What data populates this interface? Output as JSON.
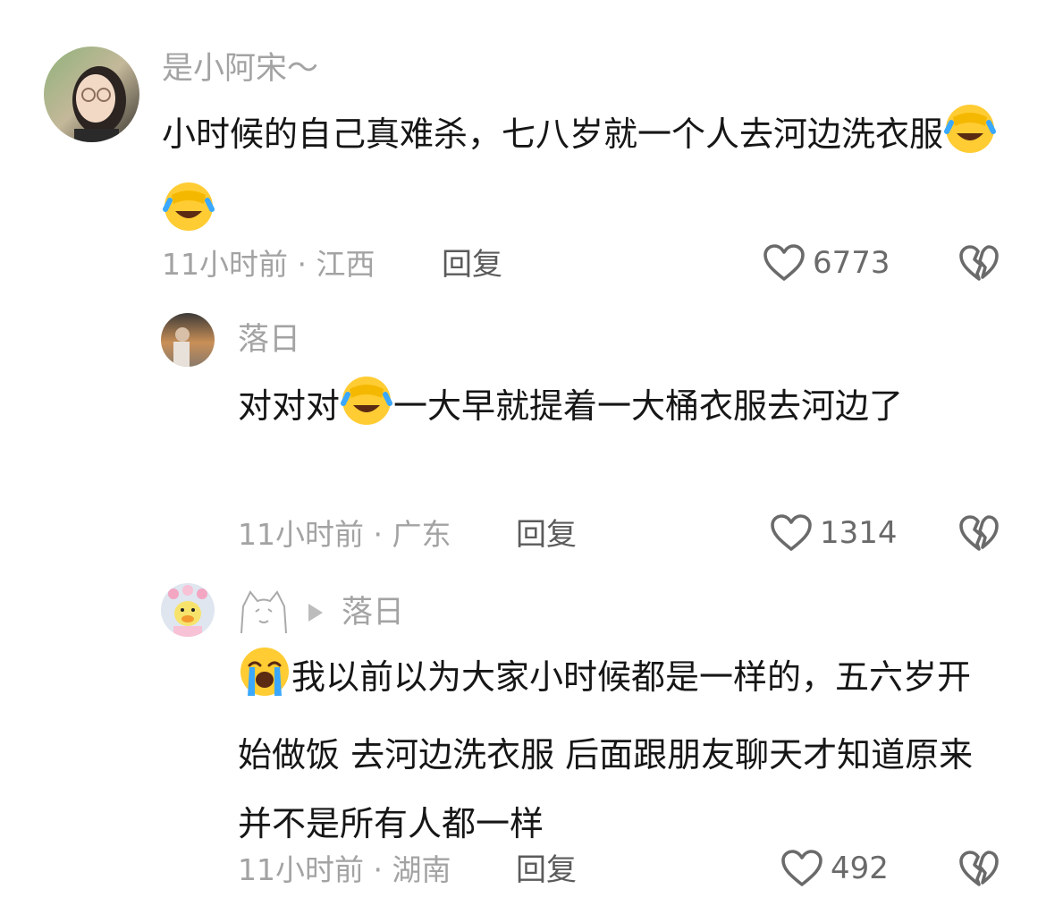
{
  "comments": [
    {
      "username": "是小阿宋～",
      "text_segments": [
        "小时候的自己真难杀，七八岁就一个人去河边洗衣服",
        ""
      ],
      "emojis": [
        "face-with-hand-laughing-crying",
        "face-with-hand-laughing-crying"
      ],
      "meta": "11小时前 · 江西",
      "reply_label": "回复",
      "likes": "6773"
    },
    {
      "username": "落日",
      "text_segments": [
        "对对对",
        "一大早就提着一大桶衣服去河边了"
      ],
      "emojis": [
        "face-with-hand-laughing-crying"
      ],
      "meta": "11小时前 · 广东",
      "reply_label": "回复",
      "likes": "1314"
    },
    {
      "reply_to": "落日",
      "text_segments": [
        "",
        "我以前以为大家小时候都是一样的，五六岁开始做饭 去河边洗衣服 后面跟朋友聊天才知道原来并不是所有人都一样"
      ],
      "emojis": [
        "loudly-crying-face"
      ],
      "meta": "11小时前 · 湖南",
      "reply_label": "回复",
      "likes": "492"
    }
  ],
  "icons": {
    "like": "heart-outline-icon",
    "dislike": "broken-heart-outline-icon",
    "reply_arrow": "play-triangle-icon",
    "username_icon": "cat-line-drawing-icon"
  },
  "colors": {
    "text": "#161616",
    "muted": "#a3a3a3",
    "reply": "#5b5b5b",
    "icon": "#6a6a6a"
  }
}
